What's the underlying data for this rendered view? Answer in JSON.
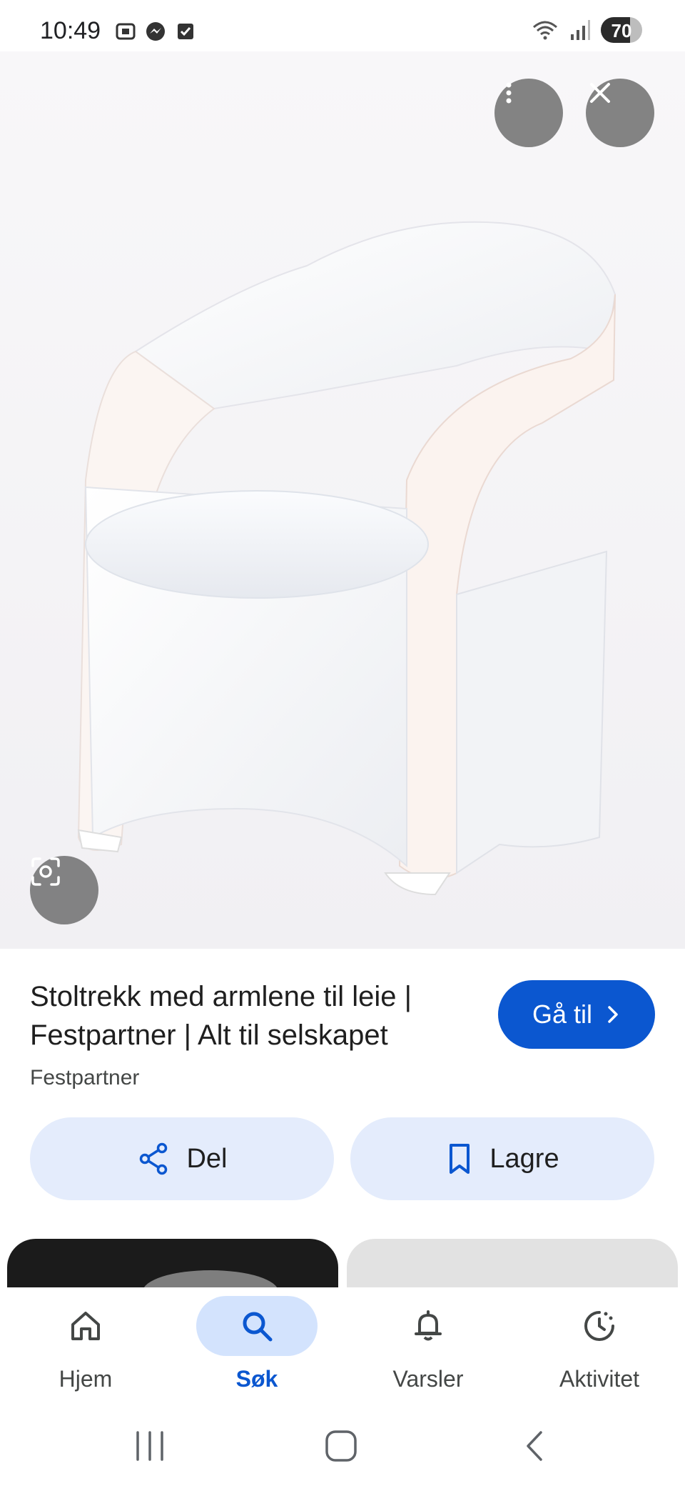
{
  "status_bar": {
    "time": "10:49",
    "battery": "70",
    "icons": [
      "screenshot-icon",
      "messenger-icon",
      "checkbox-icon",
      "wifi-icon",
      "signal-icon",
      "battery-icon"
    ]
  },
  "image_viewer": {
    "more_icon": "more-vert-icon",
    "close_icon": "close-icon",
    "lens_icon": "lens-icon"
  },
  "result": {
    "title": "Stoltrekk med armlene til leie | Festpartner | Alt til selskapet",
    "source": "Festpartner",
    "goto_label": "Gå til"
  },
  "actions": {
    "share_label": "Del",
    "save_label": "Lagre"
  },
  "bottom_nav": {
    "items": [
      {
        "label": "Hjem",
        "icon": "home-icon",
        "active": false
      },
      {
        "label": "Søk",
        "icon": "search-icon",
        "active": true
      },
      {
        "label": "Varsler",
        "icon": "bell-icon",
        "active": false
      },
      {
        "label": "Aktivitet",
        "icon": "activity-icon",
        "active": false
      }
    ]
  },
  "colors": {
    "accent": "#0b57d0",
    "pill_bg": "#e4ecfc",
    "nav_active_bg": "#d3e3fd"
  }
}
